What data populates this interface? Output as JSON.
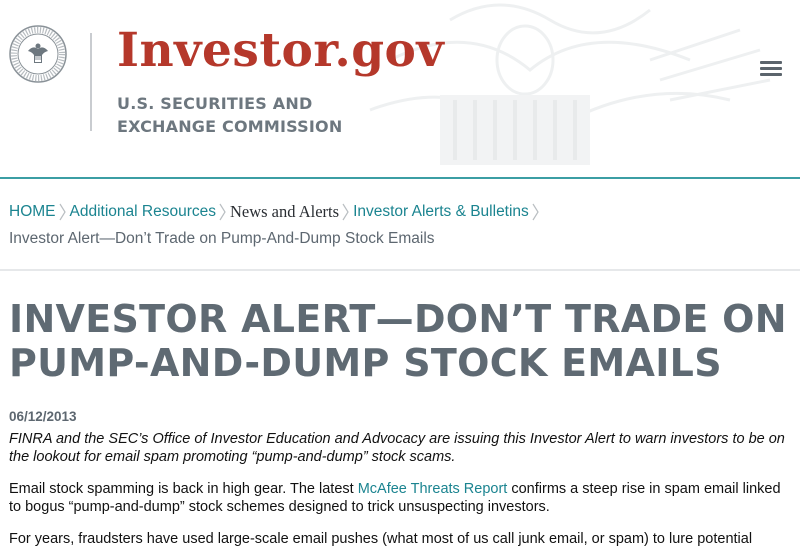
{
  "site": {
    "logo_text": "Investor.gov",
    "agency_line1": "U.S. SECURITIES AND",
    "agency_line2": "EXCHANGE COMMISSION",
    "colors": {
      "logo": "#b5382b",
      "teal": "#1b8490",
      "heading": "#5f6a73"
    }
  },
  "breadcrumb": {
    "items": [
      {
        "label": "HOME",
        "link": true
      },
      {
        "label": "Additional Resources",
        "link": true
      },
      {
        "label": "News and Alerts",
        "link": false
      },
      {
        "label": "Investor Alerts & Bulletins",
        "link": true
      }
    ],
    "current": "Investor Alert—Don’t Trade on Pump-And-Dump Stock Emails"
  },
  "article": {
    "title_line1": "INVESTOR ALERT—DON’T TRADE ON",
    "title_line2": "PUMP-AND-DUMP STOCK EMAILS",
    "date": "06/12/2013",
    "lede_line1": "FINRA and the SEC’s Office of Investor Education and Advocacy are issuing this Investor Alert to warn investors to be on",
    "lede_line2": "the lookout for email spam promoting “pump-and-dump” stock scams.",
    "p1_before": "Email stock spamming is back in high gear.  The latest ",
    "p1_link": "McAfee Threats Report",
    "p1_after": " confirms a steep rise in spam email linked",
    "p1_line2": "to bogus “pump-and-dump” stock schemes designed to trick unsuspecting investors.",
    "p2_line1": "For years, fraudsters have used large-scale email pushes (what most of us call junk email, or spam) to lure potential"
  }
}
